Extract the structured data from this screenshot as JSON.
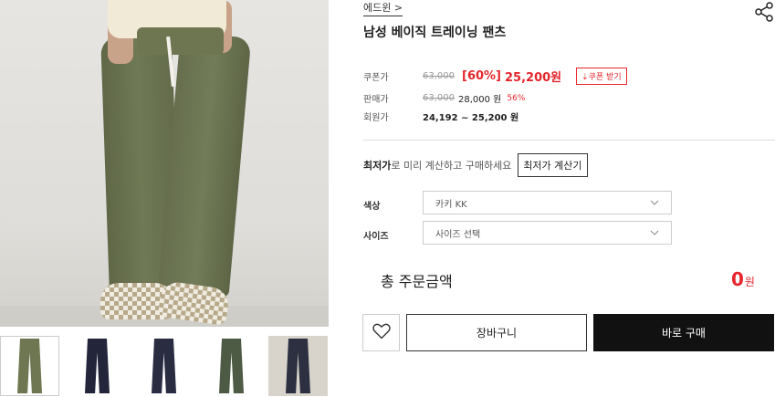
{
  "product": {
    "brand": "에드윈 >",
    "title": "남성 베이직 트레이닝 팬츠"
  },
  "pricing": {
    "coupon": {
      "label": "쿠폰가",
      "original": "63,000",
      "rate": "[60%]",
      "price": "25,200원",
      "button": "⇣쿠폰 받기"
    },
    "sale": {
      "label": "판매가",
      "original": "63,000",
      "price": "28,000 원",
      "rate": "56%"
    },
    "member": {
      "label": "회원가",
      "range": "24,192 ~ 25,200 원"
    }
  },
  "lowest_price": {
    "bold": "최저가",
    "text": "로 미리 계산하고 구매하세요",
    "button": "최저가 계산기"
  },
  "options": {
    "color": {
      "label": "색상",
      "value": "카키 KK"
    },
    "size": {
      "label": "사이즈",
      "value": "사이즈 선택"
    }
  },
  "total": {
    "label": "총 주문금액",
    "value": "0",
    "unit": "원"
  },
  "actions": {
    "cart": "장바구니",
    "buy": "바로 구매"
  },
  "thumbnails": [
    {
      "name": "thumb-khaki-model",
      "color": "#6f7752"
    },
    {
      "name": "thumb-navy-front",
      "color": "#23253a"
    },
    {
      "name": "thumb-navy-back",
      "color": "#2a2c42"
    },
    {
      "name": "thumb-khaki-flat",
      "color": "#4d5a44"
    },
    {
      "name": "thumb-navy-model",
      "color": "#2c3040"
    }
  ],
  "colors": {
    "accent_red": "#e5262c",
    "buy_button": "#111111"
  }
}
